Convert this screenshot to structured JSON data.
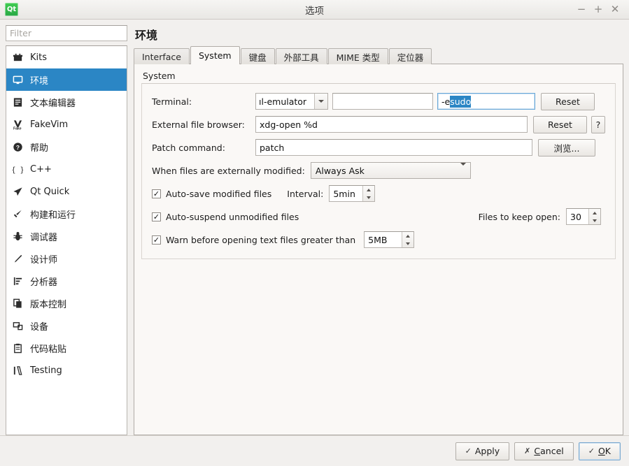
{
  "window": {
    "title": "选项",
    "logo_icon": "qt-logo-icon",
    "logo_text": "Qt",
    "minimize_icon": "−",
    "maximize_icon": "+",
    "close_icon": "✕"
  },
  "sidebar": {
    "filter": {
      "value": "",
      "placeholder": "Filter"
    },
    "items": [
      {
        "label": "Kits",
        "icon": "kits-icon",
        "selected": false
      },
      {
        "label": "环境",
        "icon": "environment-icon",
        "selected": true
      },
      {
        "label": "文本编辑器",
        "icon": "text-editor-icon",
        "selected": false
      },
      {
        "label": "FakeVim",
        "icon": "fakevim-icon",
        "selected": false
      },
      {
        "label": "帮助",
        "icon": "help-icon",
        "selected": false
      },
      {
        "label": "C++",
        "icon": "cpp-icon",
        "selected": false
      },
      {
        "label": "Qt Quick",
        "icon": "qtquick-icon",
        "selected": false
      },
      {
        "label": "构建和运行",
        "icon": "build-run-icon",
        "selected": false
      },
      {
        "label": "调试器",
        "icon": "debugger-icon",
        "selected": false
      },
      {
        "label": "设计师",
        "icon": "designer-icon",
        "selected": false
      },
      {
        "label": "分析器",
        "icon": "analyzer-icon",
        "selected": false
      },
      {
        "label": "版本控制",
        "icon": "version-control-icon",
        "selected": false
      },
      {
        "label": "设备",
        "icon": "devices-icon",
        "selected": false
      },
      {
        "label": "代码粘贴",
        "icon": "code-pasting-icon",
        "selected": false
      },
      {
        "label": "Testing",
        "icon": "testing-icon",
        "selected": false
      }
    ]
  },
  "page": {
    "title": "环境",
    "tabs": [
      {
        "label": "Interface",
        "active": false
      },
      {
        "label": "System",
        "active": true
      },
      {
        "label": "键盘",
        "active": false
      },
      {
        "label": "外部工具",
        "active": false
      },
      {
        "label": "MIME 类型",
        "active": false
      },
      {
        "label": "定位器",
        "active": false
      }
    ],
    "group_label": "System",
    "terminal": {
      "label": "Terminal:",
      "combo_value": "ıl-emulator",
      "arg_field_value": "",
      "exec_field_prefix": "-e ",
      "exec_field_selected": "sudo",
      "reset_label": "Reset"
    },
    "file_browser": {
      "label": "External file browser:",
      "value": "xdg-open %d",
      "reset_label": "Reset",
      "help_label": "?"
    },
    "patch": {
      "label": "Patch command:",
      "value": "patch",
      "browse_label": "浏览..."
    },
    "externally_modified": {
      "label": "When files are externally modified:",
      "value": "Always Ask"
    },
    "autosave": {
      "label": "Auto-save modified files",
      "checked": true,
      "check_glyph": "✓",
      "interval_label": "Interval:",
      "interval_value": "5min"
    },
    "autosuspend": {
      "label": "Auto-suspend unmodified files",
      "checked": true,
      "check_glyph": "✓",
      "keep_open_label": "Files to keep open:",
      "keep_open_value": "30"
    },
    "warn_large": {
      "label": "Warn before opening text files greater than",
      "checked": true,
      "check_glyph": "✓",
      "size_value": "5MB"
    }
  },
  "footer": {
    "apply": {
      "label": "Apply",
      "icon": "✓"
    },
    "cancel": {
      "label": "Cancel",
      "icon": "✗",
      "mnemonic": "C",
      "rest": "ancel"
    },
    "ok": {
      "label": "OK",
      "icon": "✓",
      "mnemonic": "O",
      "rest": "K"
    }
  },
  "colors": {
    "selection_blue": "#2b86c5",
    "qt_green": "#41cd52",
    "panel_bg": "#faf8f6",
    "window_bg": "#f2f0ee"
  }
}
